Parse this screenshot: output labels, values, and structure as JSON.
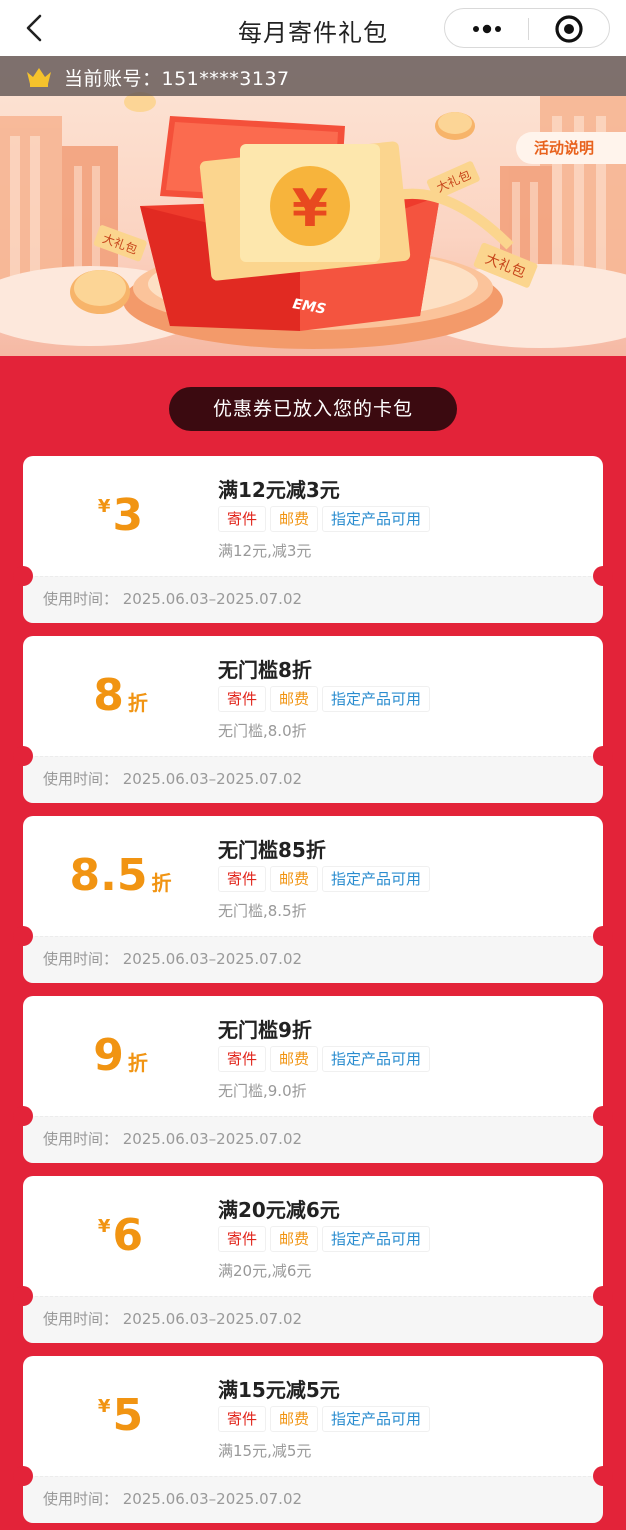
{
  "nav": {
    "title": "每月寄件礼包",
    "back_icon": "chevron-left-icon",
    "more_icon": "more-dots-icon",
    "record_icon": "target-circle-icon"
  },
  "account": {
    "label": "当前账号：151****3137",
    "icon": "crown-icon"
  },
  "hero": {
    "rules_label": "活动说明",
    "ribbon_tag_1": "大礼包",
    "ribbon_tag_2": "大礼包",
    "ribbon_tag_3": "大礼包",
    "box_logo": "EMS",
    "ticket_symbol": "¥"
  },
  "notice": "优惠券已放入您的卡包",
  "colors": {
    "page_bg": "#e32339",
    "amount": "#f19412",
    "tag_red": "#e1251b",
    "tag_orange": "#f19412",
    "tag_blue": "#2a8ccf"
  },
  "coupons": [
    {
      "symbol": "¥",
      "value": "3",
      "unit": "",
      "title": "满12元减3元",
      "tags": [
        "寄件",
        "邮费",
        "指定产品可用"
      ],
      "desc": "满12元,减3元",
      "time": "使用时间：  2025.06.03–2025.07.02"
    },
    {
      "symbol": "",
      "value": "8",
      "unit": "折",
      "title": "无门槛8折",
      "tags": [
        "寄件",
        "邮费",
        "指定产品可用"
      ],
      "desc": "无门槛,8.0折",
      "time": "使用时间：  2025.06.03–2025.07.02"
    },
    {
      "symbol": "",
      "value": "8.5",
      "unit": "折",
      "title": "无门槛85折",
      "tags": [
        "寄件",
        "邮费",
        "指定产品可用"
      ],
      "desc": "无门槛,8.5折",
      "time": "使用时间：  2025.06.03–2025.07.02"
    },
    {
      "symbol": "",
      "value": "9",
      "unit": "折",
      "title": "无门槛9折",
      "tags": [
        "寄件",
        "邮费",
        "指定产品可用"
      ],
      "desc": "无门槛,9.0折",
      "time": "使用时间：  2025.06.03–2025.07.02"
    },
    {
      "symbol": "¥",
      "value": "6",
      "unit": "",
      "title": "满20元减6元",
      "tags": [
        "寄件",
        "邮费",
        "指定产品可用"
      ],
      "desc": "满20元,减6元",
      "time": "使用时间：  2025.06.03–2025.07.02"
    },
    {
      "symbol": "¥",
      "value": "5",
      "unit": "",
      "title": "满15元减5元",
      "tags": [
        "寄件",
        "邮费",
        "指定产品可用"
      ],
      "desc": "满15元,减5元",
      "time": "使用时间：  2025.06.03–2025.07.02"
    }
  ]
}
